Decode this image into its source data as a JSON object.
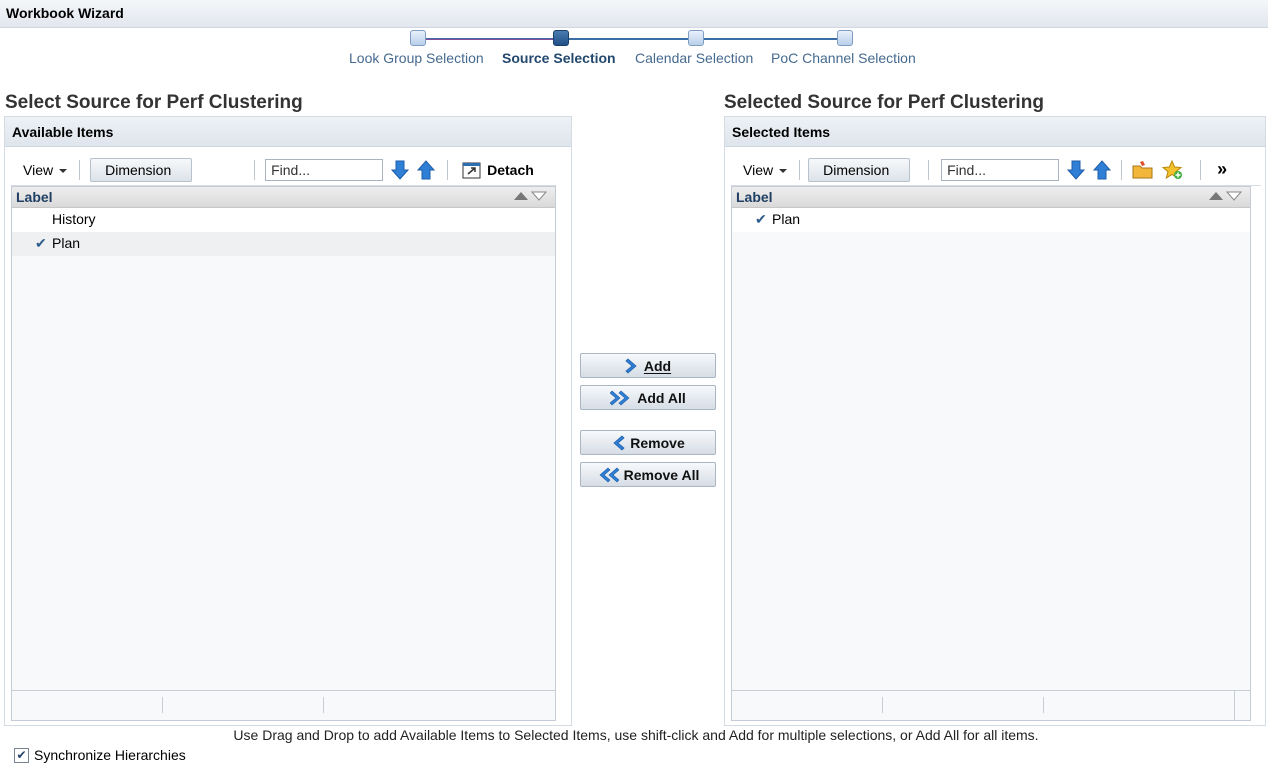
{
  "window": {
    "title": "Workbook Wizard"
  },
  "train": {
    "steps": [
      {
        "label": "Look Group Selection"
      },
      {
        "label": "Source Selection"
      },
      {
        "label": "Calendar Selection"
      },
      {
        "label": "PoC Channel Selection"
      }
    ],
    "current_index": 1
  },
  "left": {
    "title": "Select Source for Perf Clustering",
    "panel_header": "Available Items",
    "toolbar": {
      "view": "View",
      "dimension": "Dimension",
      "find_placeholder": "Find...",
      "detach": "Detach"
    },
    "grid": {
      "column": "Label",
      "rows": [
        {
          "label": "History",
          "checked": false
        },
        {
          "label": "Plan",
          "checked": true
        }
      ]
    }
  },
  "right": {
    "title": "Selected Source for Perf Clustering",
    "panel_header": "Selected Items",
    "toolbar": {
      "view": "View",
      "dimension": "Dimension",
      "find_placeholder": "Find...",
      "overflow": "»"
    },
    "grid": {
      "column": "Label",
      "rows": [
        {
          "label": "Plan",
          "checked": true
        }
      ]
    }
  },
  "shuttle": {
    "add": "Add",
    "add_all": "Add All",
    "remove": "Remove",
    "remove_all": "Remove All"
  },
  "hint": "Use Drag and Drop to add Available Items to Selected Items, use shift-click and Add for multiple selections, or Add All for all items.",
  "sync": {
    "label": "Synchronize Hierarchies",
    "checked": true
  },
  "colors": {
    "accent": "#1f4f86",
    "arrow_blue": "#2f7fd6",
    "link_text": "#466a8f"
  }
}
